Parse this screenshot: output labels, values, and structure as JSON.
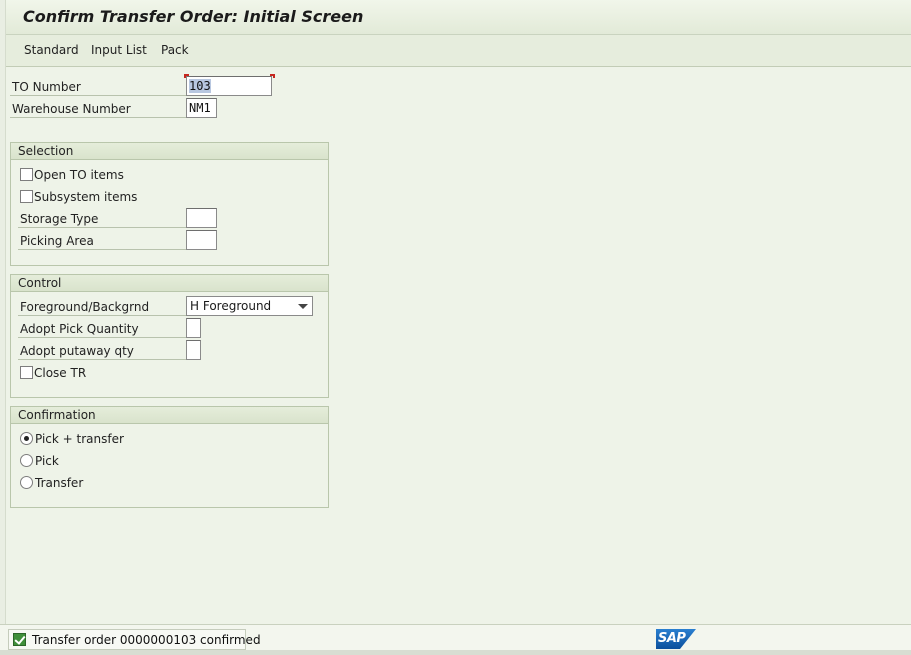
{
  "window": {
    "title": "Confirm Transfer Order: Initial Screen"
  },
  "menu": {
    "items": [
      "Standard",
      "Input List",
      "Pack"
    ]
  },
  "header_fields": {
    "to_number": {
      "label": "TO Number",
      "value": "103"
    },
    "warehouse_number": {
      "label": "Warehouse Number",
      "value": "NM1"
    }
  },
  "selection": {
    "title": "Selection",
    "open_to_items": {
      "label": "Open TO items",
      "checked": false
    },
    "subsystem_items": {
      "label": "Subsystem items",
      "checked": false
    },
    "storage_type": {
      "label": "Storage Type",
      "value": ""
    },
    "picking_area": {
      "label": "Picking Area",
      "value": ""
    }
  },
  "control": {
    "title": "Control",
    "foreground_backgrnd": {
      "label": "Foreground/Backgrnd",
      "value": "H Foreground"
    },
    "adopt_pick_quantity": {
      "label": "Adopt Pick Quantity",
      "value": ""
    },
    "adopt_putaway_qty": {
      "label": "Adopt putaway qty",
      "value": ""
    },
    "close_tr": {
      "label": "Close TR",
      "checked": false
    }
  },
  "confirmation": {
    "title": "Confirmation",
    "options": [
      {
        "label": "Pick + transfer",
        "selected": true
      },
      {
        "label": "Pick",
        "selected": false
      },
      {
        "label": "Transfer",
        "selected": false
      }
    ]
  },
  "status": {
    "message": "Transfer order 0000000103 confirmed",
    "type": "success"
  },
  "logo": {
    "text": "SAP"
  }
}
